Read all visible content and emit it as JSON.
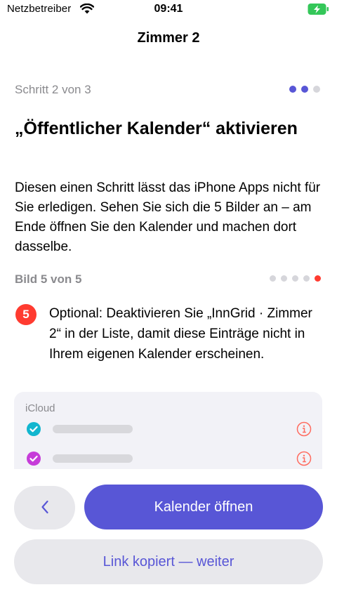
{
  "status_bar": {
    "carrier": "Netzbetreiber",
    "time": "09:41"
  },
  "nav": {
    "title": "Zimmer 2"
  },
  "step": {
    "label": "Schritt 2 von 3",
    "current": 2,
    "total": 3
  },
  "heading": "„Öffentlicher Kalender“ aktivieren",
  "description": "Diesen einen Schritt lässt das iPhone Apps nicht für Sie erledigen. Sehen Sie sich die 5 Bilder an – am Ende öffnen Sie den Kalender und machen dort dasselbe.",
  "image_nav": {
    "label": "Bild 5 von 5",
    "current": 5,
    "total": 5
  },
  "instruction": {
    "number": "5",
    "text": "Optional: Deaktivieren Sie „InnGrid · Zimmer 2“ in der Liste, damit diese Einträge nicht in Ihrem eigenen Kalender erscheinen."
  },
  "calendar_preview": {
    "section_header": "iCloud",
    "rows": [
      {
        "color": "#12b6cf",
        "checked": true
      },
      {
        "color": "#c63cd9",
        "checked": true
      }
    ],
    "info_color": "#ff6b5f"
  },
  "buttons": {
    "back_icon": "chevron-left-icon",
    "primary_label": "Kalender öffnen",
    "secondary_label": "Link kopiert — weiter"
  },
  "colors": {
    "accent": "#5856d6",
    "alert": "#ff3b30",
    "battery": "#34c759"
  }
}
